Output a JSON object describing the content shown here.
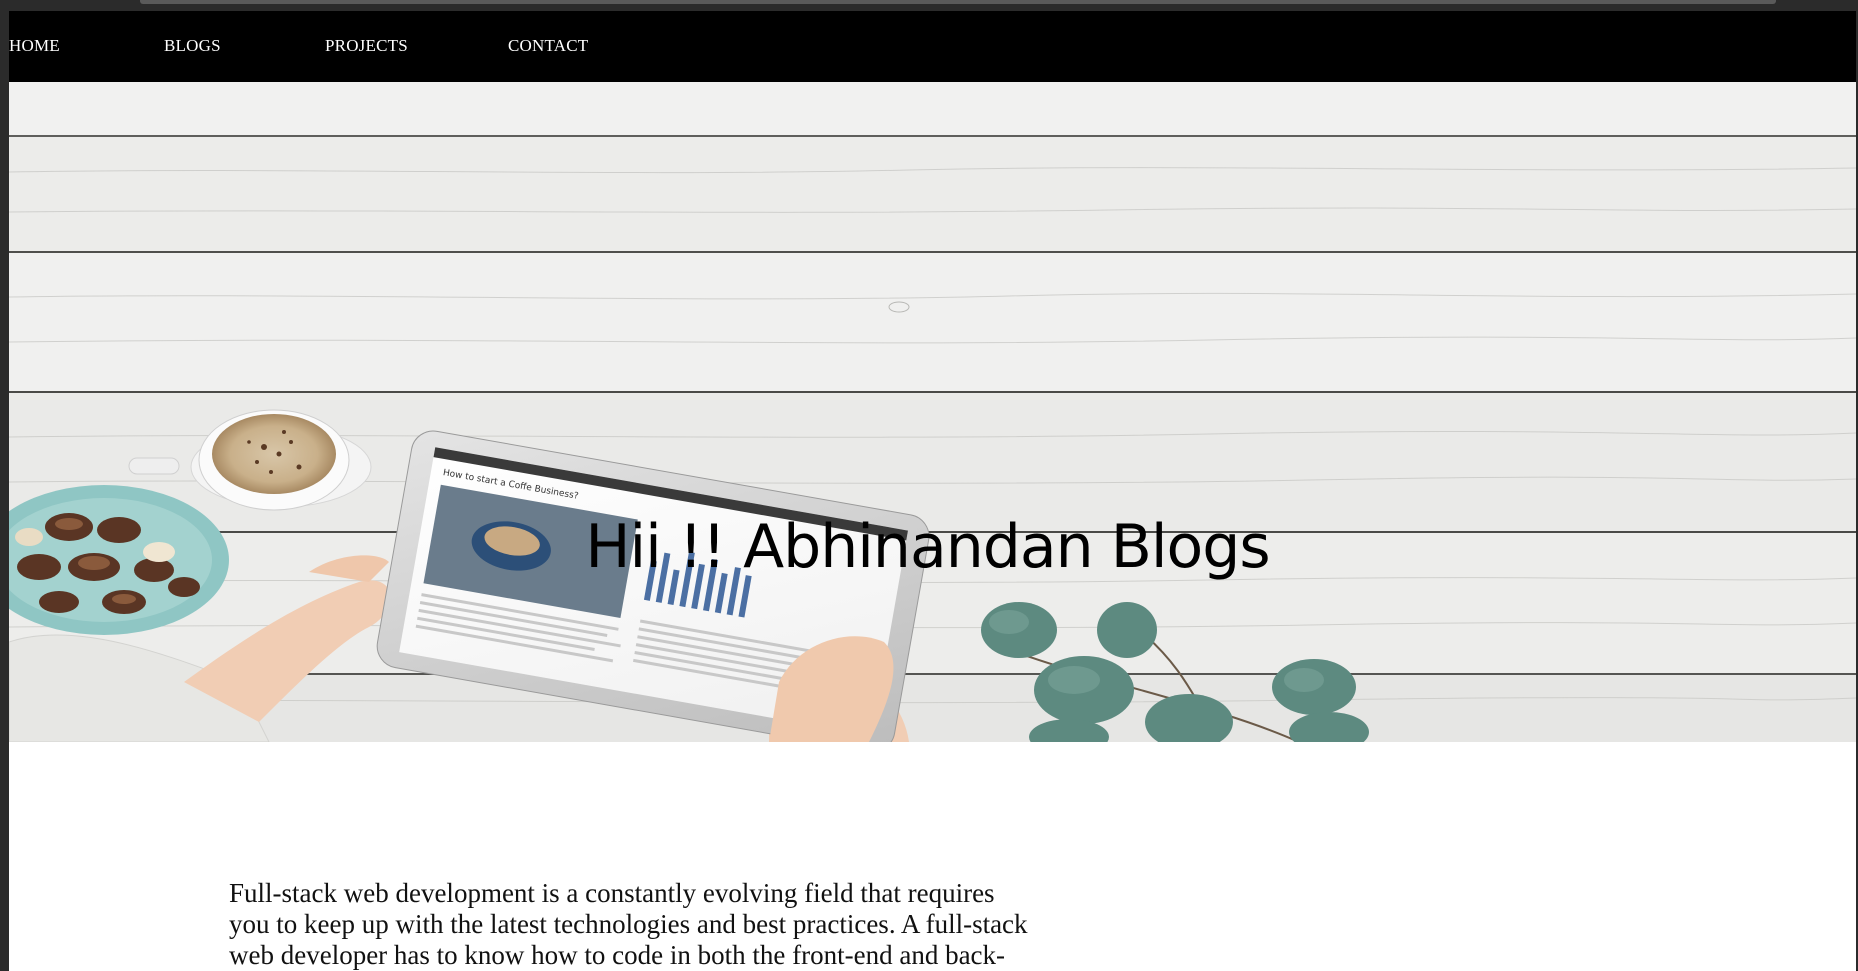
{
  "nav": {
    "items": [
      {
        "label": "HOME"
      },
      {
        "label": "BLOGS"
      },
      {
        "label": "PROJECTS"
      },
      {
        "label": "CONTACT"
      }
    ]
  },
  "hero": {
    "title": "Hii !! Abhinandan Blogs",
    "image": "white-wood-desk-with-tablet-coffee-cookies-eucalyptus",
    "tablet_article_title": "How to start a Coffe Business?"
  },
  "main": {
    "intro_text": "Full-stack web development is a constantly evolving field that requires you to keep up with the latest technologies and best practices. A full-stack web developer has to know how to code in both the front-end and back-"
  },
  "colors": {
    "navbar_background": "#000000",
    "nav_text": "#ffffff",
    "hero_title": "#000000",
    "body_text": "#111111"
  }
}
